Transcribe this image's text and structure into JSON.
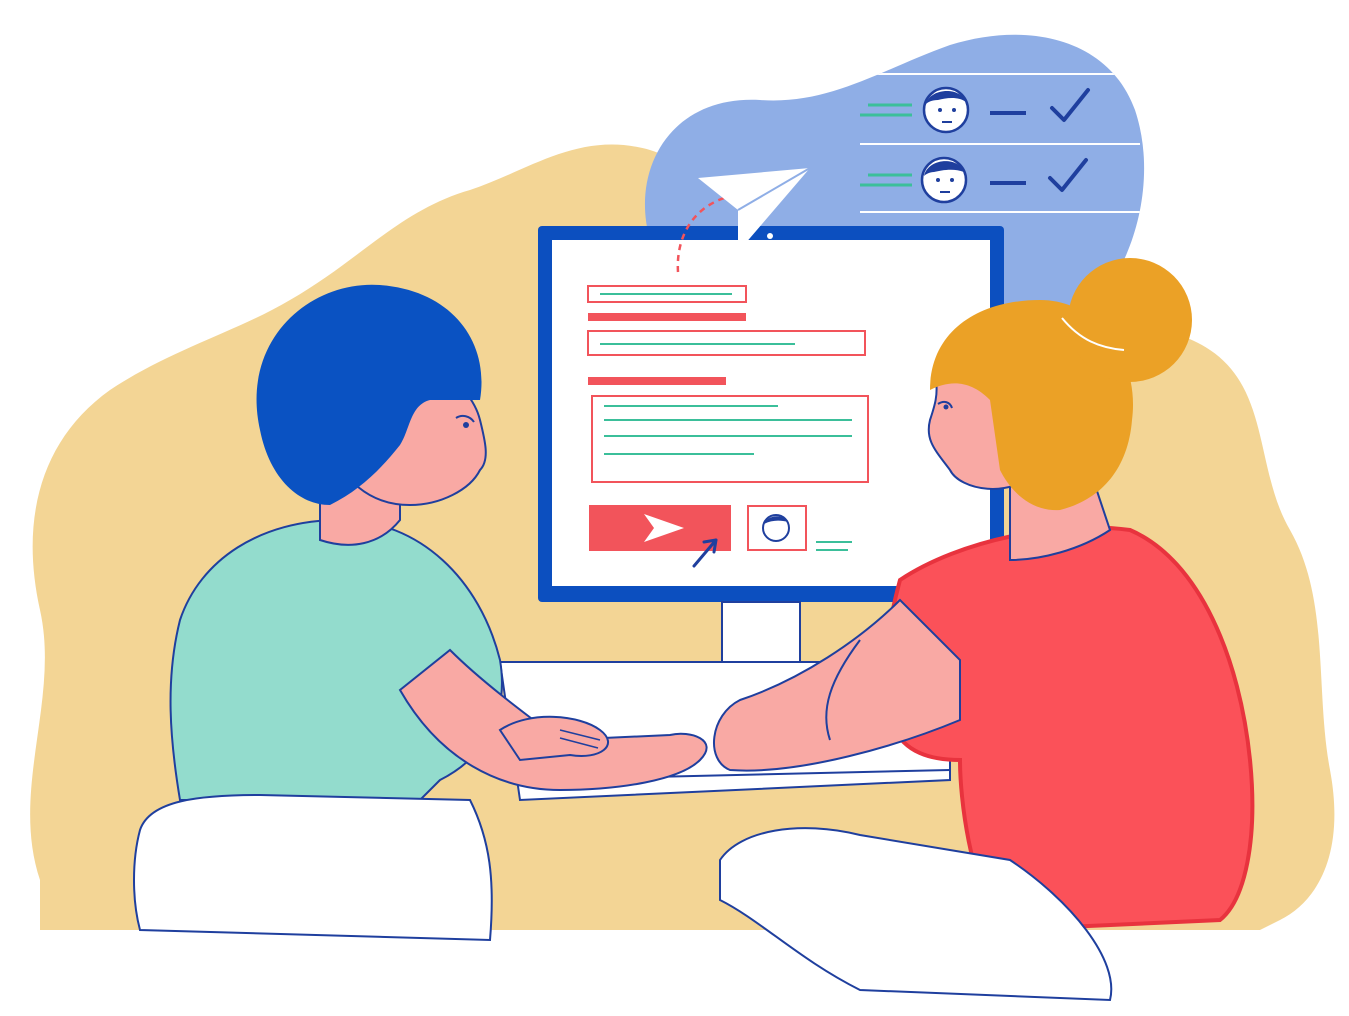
{
  "illustration": {
    "colors": {
      "background_blob": "#f3d595",
      "bubble": "#8faee6",
      "monitor_frame": "#0c4fbf",
      "accent_red": "#f2545b",
      "accent_green": "#3bbf9a",
      "hair_blue": "#0a52c2",
      "hair_orange": "#eba126",
      "shirt_teal": "#93dccd",
      "shirt_red": "#fb5159",
      "skin": "#f9a9a4",
      "outline": "#1f3f9e"
    },
    "icons": {
      "paper_plane": "paper-plane-icon",
      "send": "send-arrow-icon",
      "cursor": "mouse-cursor-icon",
      "checkmark": "checkmark-icon",
      "avatar": "avatar-icon"
    },
    "notification_rows": 2
  }
}
